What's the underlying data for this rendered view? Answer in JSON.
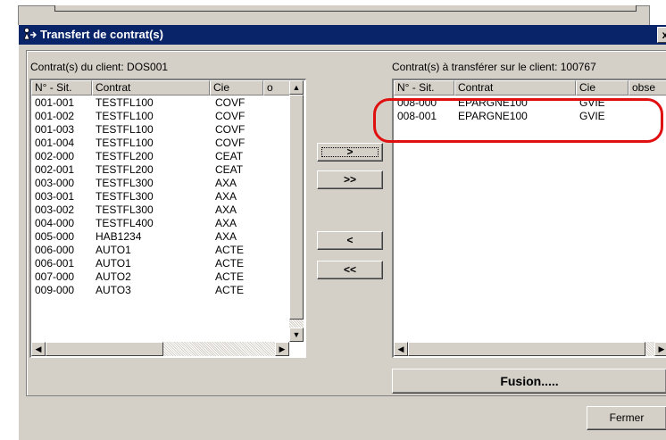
{
  "dialog": {
    "title": "Transfert de contrat(s)",
    "close_glyph": "x"
  },
  "left": {
    "label": "Contrat(s) du client: DOS001",
    "columns": [
      "N° - Sit.",
      "Contrat",
      "Cie",
      "o"
    ],
    "rows": [
      [
        "001-001",
        "TESTFL100",
        "COVF"
      ],
      [
        "001-002",
        "TESTFL100",
        "COVF"
      ],
      [
        "001-003",
        "TESTFL100",
        "COVF"
      ],
      [
        "001-004",
        "TESTFL100",
        "COVF"
      ],
      [
        "002-000",
        "TESTFL200",
        "CEAT"
      ],
      [
        "002-001",
        "TESTFL200",
        "CEAT"
      ],
      [
        "003-000",
        "TESTFL300",
        "AXA"
      ],
      [
        "003-001",
        "TESTFL300",
        "AXA"
      ],
      [
        "003-002",
        "TESTFL300",
        "AXA"
      ],
      [
        "004-000",
        "TESTFL400",
        "AXA"
      ],
      [
        "005-000",
        "HAB1234",
        "AXA"
      ],
      [
        "006-000",
        "AUTO1",
        "ACTE"
      ],
      [
        "006-001",
        "AUTO1",
        "ACTE"
      ],
      [
        "007-000",
        "AUTO2",
        "ACTE"
      ],
      [
        "009-000",
        "AUTO3",
        "ACTE"
      ]
    ]
  },
  "right": {
    "label": "Contrat(s) à transférer sur le client: 100767",
    "columns": [
      "N° - Sit.",
      "Contrat",
      "Cie",
      "obse"
    ],
    "rows": [
      [
        "008-000",
        "EPARGNE100",
        "GVIE"
      ],
      [
        "008-001",
        "EPARGNE100",
        "GVIE"
      ]
    ]
  },
  "buttons": {
    "move_one_right": ">",
    "move_all_right": ">>",
    "move_one_left": "<",
    "move_all_left": "<<",
    "fusion": "Fusion.....",
    "close": "Fermer"
  },
  "icons": {
    "up": "▲",
    "down": "▼",
    "left": "◀",
    "right": "▶"
  },
  "colors": {
    "titlebar": "#0a246a",
    "highlight_ring": "#e01010"
  }
}
